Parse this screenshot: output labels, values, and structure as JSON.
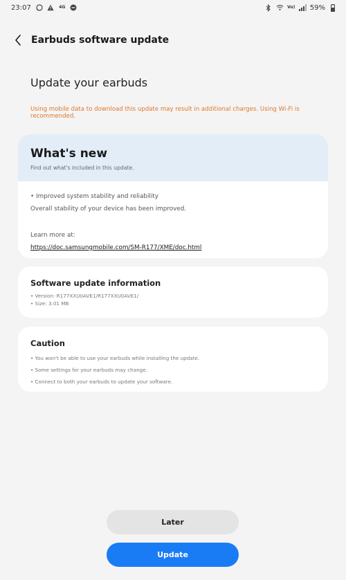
{
  "status_bar": {
    "time": "23:07",
    "left_icons": [
      "whatsapp-icon",
      "alert-icon",
      "data-icon",
      "minus-circle-icon"
    ],
    "data_label": "4G",
    "right_icons": [
      "bluetooth-icon",
      "wifi-icon",
      "volte-icon",
      "signal-icon"
    ],
    "volte_label": "Vo)",
    "battery": "59%"
  },
  "app_bar": {
    "title": "Earbuds software update"
  },
  "main": {
    "heading": "Update your earbuds",
    "warning": "Using mobile data to download this update may result in additional charges. Using Wi-Fi is recommended."
  },
  "whats_new": {
    "title": "What's new",
    "subtitle": "Find out what's included in this update.",
    "line1": "• Improved system stability and reliability",
    "line2": "Overall stability of your device has been improved.",
    "learn_more": "Learn more at:",
    "link": "https://doc.samsungmobile.com/SM-R177/XME/doc.html"
  },
  "software_info": {
    "title": "Software update information",
    "version": "• Version: R177XXU0AVE1/R177XXU0AVE1/",
    "size": "• Size: 3.01 MB"
  },
  "caution": {
    "title": "Caution",
    "items": [
      "• You won't be able to use your earbuds while installing the update.",
      "• Some settings for your earbuds may change.",
      "• Connect to both your earbuds to update your software."
    ]
  },
  "buttons": {
    "later": "Later",
    "update": "Update"
  },
  "colors": {
    "background": "#f4f4f4",
    "warning": "#e0782a",
    "header_tint": "#e2edf8",
    "primary_button": "#1a7cf5",
    "secondary_button": "#e4e4e4"
  }
}
